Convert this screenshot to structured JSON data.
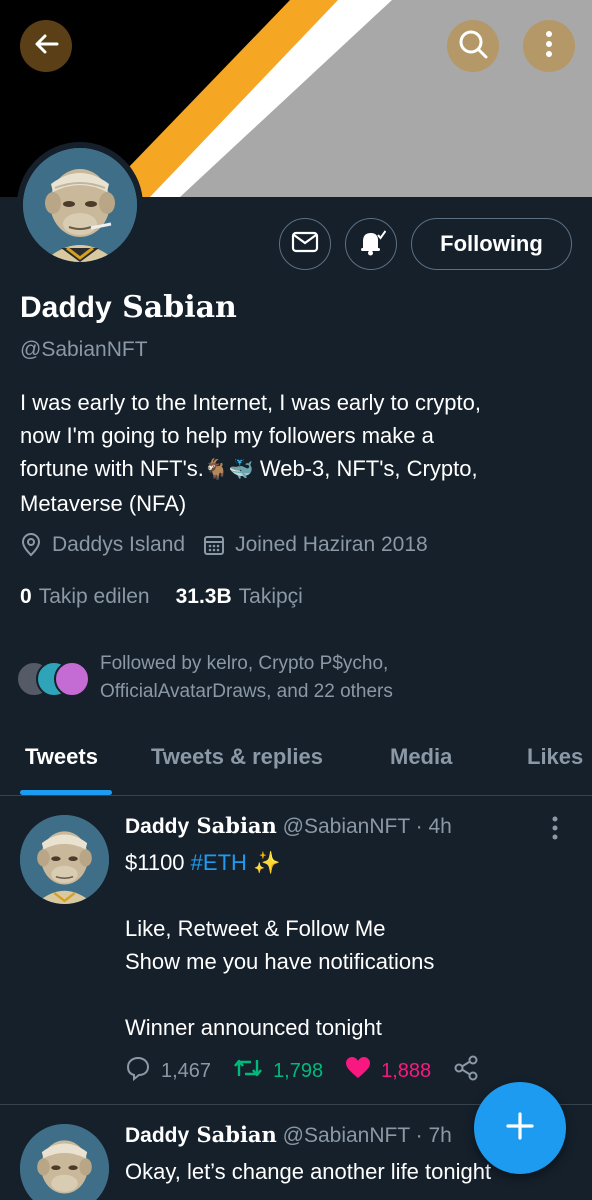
{
  "profile": {
    "display_name_first": "Daddy",
    "display_name_second": "Sabian",
    "handle": "@SabianNFT",
    "bio_line1": "I was early to the Internet, I was early to crypto,",
    "bio_line2": "now I'm going to help my followers make a",
    "bio_line3_prefix": "fortune with NFT's.",
    "bio_emoji_goat": "🐐",
    "bio_emoji_whale": "🐳",
    "bio_line3_suffix": " Web-3, NFT's, Crypto,",
    "bio_line4": "Metaverse (NFA)",
    "location": "Daddys Island",
    "joined": "Joined Haziran 2018",
    "following_count": "0",
    "following_label": "Takip edilen",
    "followers_count": "31.3B",
    "followers_label": "Takipçi",
    "followed_by_line1": "Followed by kelro, Crypto P$ycho,",
    "followed_by_line2": "OfficialAvatarDraws, and 22 others",
    "follow_button_label": "Following"
  },
  "tabs": [
    {
      "label": "Tweets",
      "active": true
    },
    {
      "label": "Tweets & replies",
      "active": false
    },
    {
      "label": "Media",
      "active": false
    },
    {
      "label": "Likes",
      "active": false
    }
  ],
  "tweets": [
    {
      "name_first": "Daddy",
      "name_second": "Sabian",
      "handle": "@SabianNFT",
      "time": "· 4h",
      "body_price": "$1100 ",
      "body_hashtag": "#ETH",
      "body_sparkle": " ✨",
      "body_line2": "Like, Retweet & Follow Me",
      "body_line3": "Show me you have notifications",
      "body_line4": "Winner announced tonight",
      "replies": "1,467",
      "retweets": "1,798",
      "likes": "1,888"
    },
    {
      "name_first": "Daddy",
      "name_second": "Sabian",
      "handle": "@SabianNFT",
      "time": "· 7h",
      "body_line1": "Okay, let’s change another life tonight"
    }
  ],
  "colors": {
    "background": "#15202b",
    "accent": "#1d9bf0",
    "muted": "#8b98a5",
    "retweet": "#00ba7c",
    "like": "#f91880"
  },
  "icons": [
    "back-arrow-icon",
    "search-icon",
    "more-vertical-icon",
    "mail-icon",
    "bell-icon",
    "location-pin-icon",
    "calendar-icon",
    "reply-icon",
    "retweet-icon",
    "heart-icon",
    "share-icon",
    "plus-icon"
  ]
}
